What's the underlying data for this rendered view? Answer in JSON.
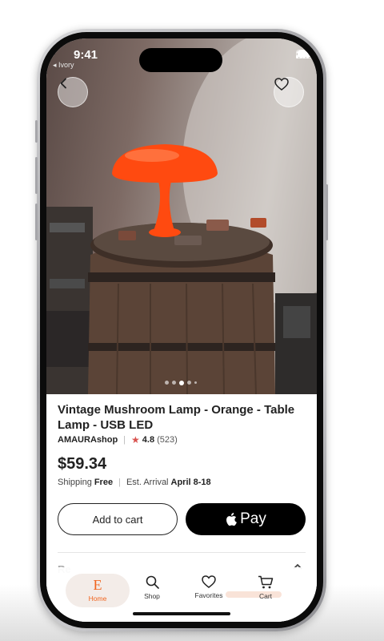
{
  "status_bar": {
    "time": "9:41",
    "back_app_label": "◂ Ivory"
  },
  "nav": {
    "back_icon": "chevron-left-icon",
    "favorite_icon": "heart-icon"
  },
  "gallery": {
    "image_count_dots": 5,
    "active_index": 2
  },
  "product": {
    "title": "Vintage Mushroom Lamp - Orange - Table Lamp - USB LED",
    "shop_name": "AMAURAshop",
    "rating": "4.8",
    "review_count": "(523)",
    "price": "$59.34",
    "shipping_label": "Shipping",
    "shipping_value": "Free",
    "arrival_label": "Est. Arrival",
    "arrival_value": "April 8-18"
  },
  "actions": {
    "add_to_cart": "Add to cart",
    "apple_pay": "Pay"
  },
  "section_peek": {
    "label": "Re"
  },
  "tabbar": {
    "items": [
      {
        "label": "Home",
        "icon": "etsy-e-icon"
      },
      {
        "label": "Shop",
        "icon": "search-icon"
      },
      {
        "label": "Favorites",
        "icon": "heart-icon"
      },
      {
        "label": "Cart",
        "icon": "cart-icon"
      }
    ]
  },
  "colors": {
    "accent": "#f1641e",
    "lamp": "#ff4a10",
    "star": "#d9534f"
  }
}
